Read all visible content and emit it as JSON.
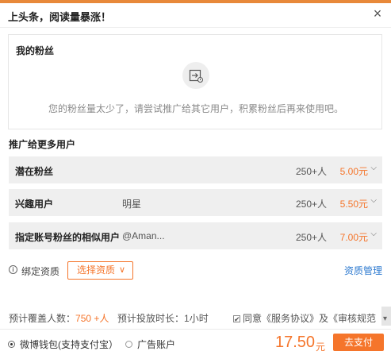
{
  "dialog": {
    "title": "上头条，阅读量暴涨！",
    "close_glyph": "×"
  },
  "fans": {
    "title": "我的粉丝",
    "empty_icon": "export-arrow-icon",
    "empty_message": "您的粉丝量太少了，请尝试推广给其它用户，积累粉丝后再来使用吧。"
  },
  "promote": {
    "section_title": "推广给更多用户",
    "rows": [
      {
        "name": "潜在粉丝",
        "detail": "",
        "count": "250+人",
        "price": "5.00元"
      },
      {
        "name": "兴趣用户",
        "detail": "明星",
        "count": "250+人",
        "price": "5.50元"
      },
      {
        "name": "指定账号粉丝的相似用户",
        "detail": "@Aman...",
        "count": "250+人",
        "price": "7.00元"
      }
    ]
  },
  "qualification": {
    "info_glyph": "i",
    "label": "绑定资质",
    "select_label": "选择资质",
    "select_arrow": "∨",
    "manage_link": "资质管理"
  },
  "summary": {
    "coverage_label": "预计覆盖人数：",
    "coverage_value": "750 +人",
    "duration_label": "预计投放时长：",
    "duration_value": "1小时",
    "agree_check": "✔",
    "agree_text": "同意《服务协议》及《审核规范"
  },
  "payment": {
    "options": [
      {
        "label": "微博钱包(支持支付宝）",
        "selected": true
      },
      {
        "label": "广告账户",
        "selected": false
      }
    ],
    "total": "17.50",
    "unit": "元",
    "pay_button": "去支付"
  },
  "colors": {
    "accent": "#f5752b",
    "link": "#2f7bd0",
    "row_bg": "#efefef"
  }
}
